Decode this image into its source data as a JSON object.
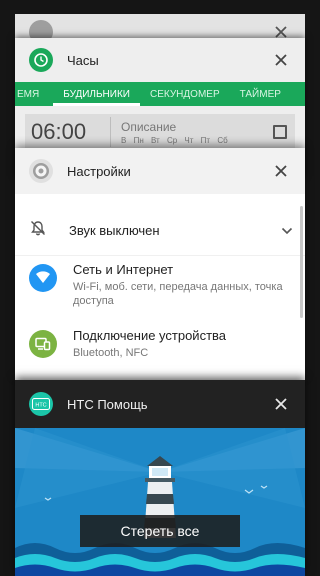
{
  "cards": {
    "back": {
      "title": ""
    },
    "clock": {
      "title": "Часы",
      "tabs": [
        "ЕМЯ",
        "БУДИЛЬНИКИ",
        "СЕКУНДОМЕР",
        "ТАЙМЕР"
      ],
      "active_tab": "БУДИЛЬНИКИ",
      "alarm": {
        "time": "06:00",
        "description": "Описание",
        "days": [
          "В",
          "Пн",
          "Вт",
          "Ср",
          "Чт",
          "Пт",
          "Сб"
        ]
      }
    },
    "settings": {
      "title": "Настройки",
      "sound": "Звук выключен",
      "network": {
        "title": "Сеть и Интернет",
        "subtitle": "Wi-Fi, моб. сети, передача данных, точка доступа"
      },
      "devices": {
        "title": "Подключение устройства",
        "subtitle": "Bluetooth, NFC"
      }
    },
    "htc": {
      "title": "HTC Помощь",
      "icon_text": "HTC"
    }
  },
  "clear_all": "Стереть все",
  "colors": {
    "clock_green": "#1aa85a",
    "network_blue": "#2196f3",
    "devices_green": "#7cb342",
    "htc_teal": "#1bc5a8",
    "sea_blue": "#1e88c7"
  },
  "icons": {
    "clock": "clock-icon",
    "settings": "gear-icon",
    "sound": "bell-off-icon",
    "network": "wifi-icon",
    "devices": "devices-icon",
    "close": "close-icon",
    "expand": "chevron-down-icon"
  }
}
